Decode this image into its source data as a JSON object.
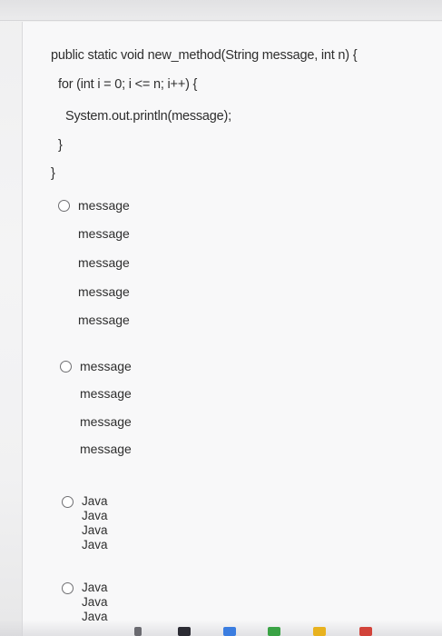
{
  "code": {
    "line1": "public static void new_method(String message, int n) {",
    "line2": "for (int i = 0; i <= n; i++) {",
    "line3": "System.out.println(message);",
    "line4": "}",
    "line5": "}"
  },
  "options": [
    {
      "lines": [
        "message",
        "message",
        "message",
        "message",
        "message"
      ]
    },
    {
      "lines": [
        "message",
        "message",
        "message",
        "message"
      ]
    },
    {
      "lines": [
        "Java",
        "Java",
        "Java",
        "Java"
      ]
    },
    {
      "lines": [
        "Java",
        "Java",
        "Java"
      ]
    }
  ],
  "colors": {
    "taskbar_green": "#3aa345",
    "taskbar_yellow": "#e8b21f",
    "taskbar_red": "#d2433a"
  }
}
